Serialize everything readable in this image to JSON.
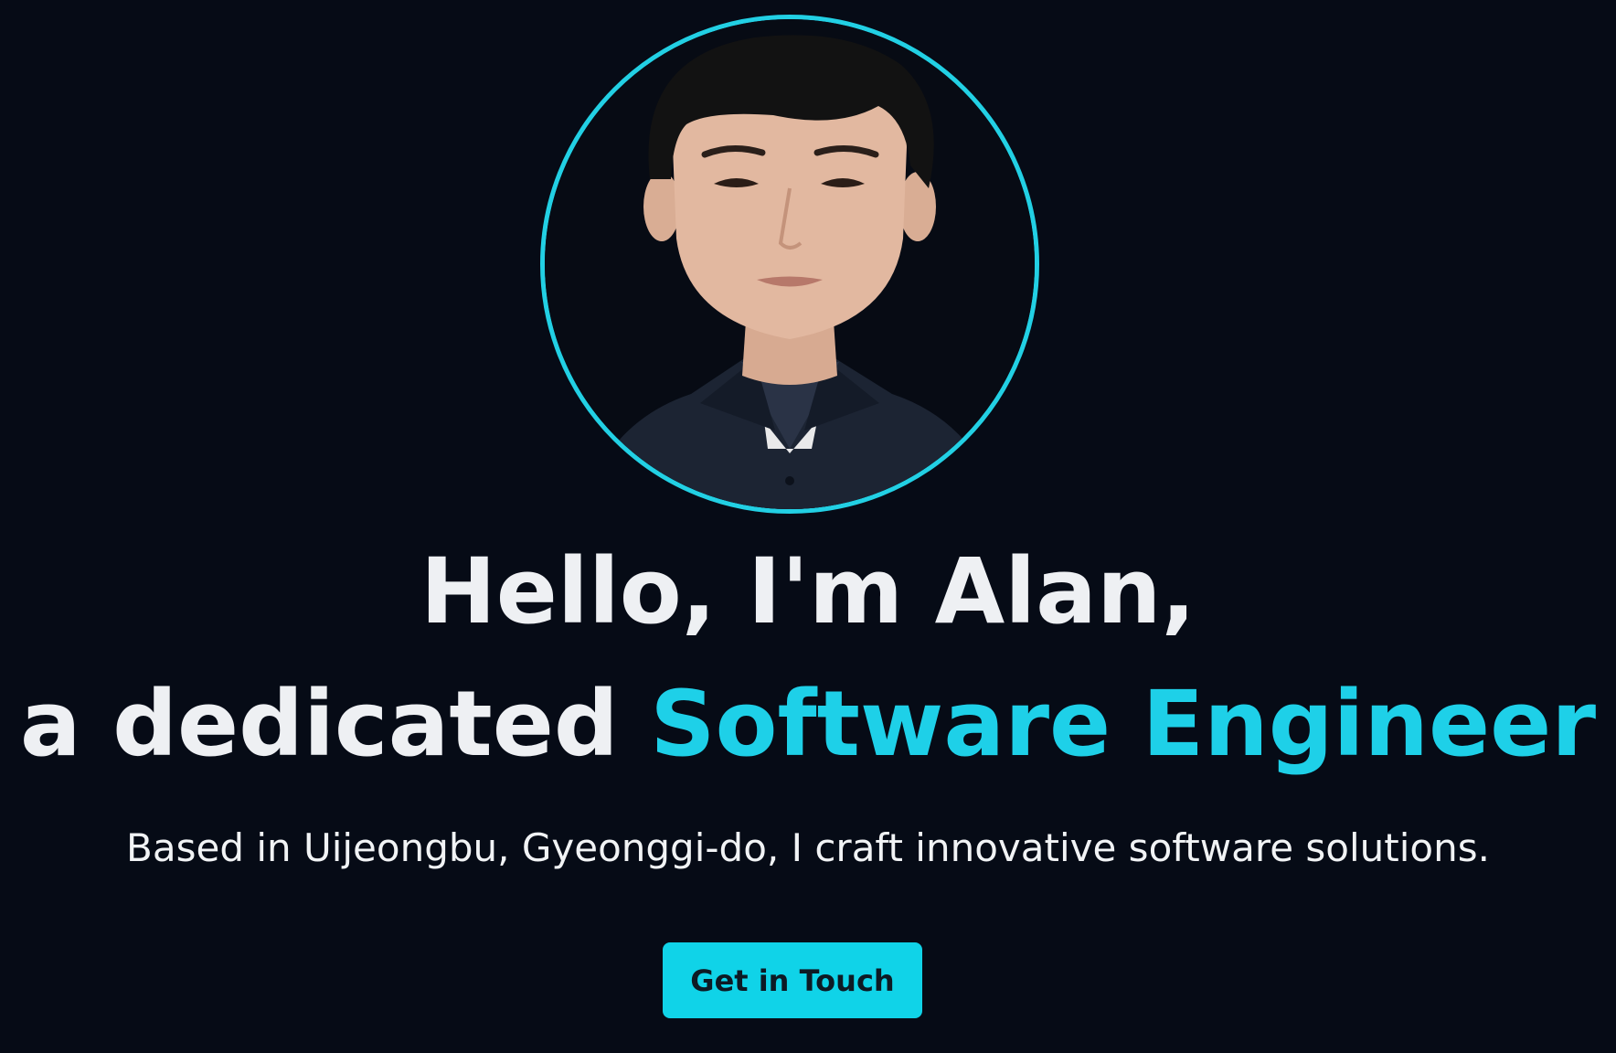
{
  "hero": {
    "avatar_alt": "Portrait photo",
    "greeting_line_1": "Hello, I'm Alan,",
    "greeting_line_2_prefix": "a dedicated ",
    "greeting_line_2_highlight": "Software Engineer",
    "subtitle": "Based in Uijeongbu, Gyeonggi-do, I craft innovative software solutions.",
    "cta_label": "Get in Touch"
  },
  "colors": {
    "background": "#060b16",
    "accent": "#1ed0e8",
    "avatar_border": "#22d0e4",
    "button_bg": "#10d3e8",
    "button_text": "#0d1a24",
    "text": "#eef0f3"
  }
}
